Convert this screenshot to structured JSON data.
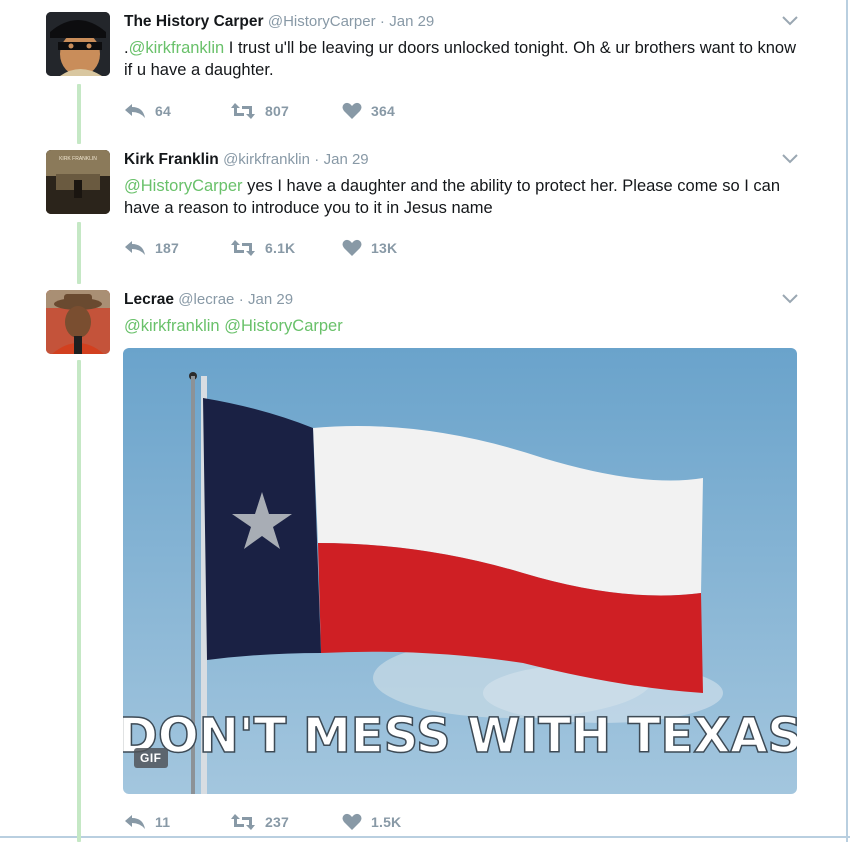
{
  "tweets": [
    {
      "name": "The History Carper",
      "handle": "@HistoryCarper",
      "date": "Jan 29",
      "text_prefix": ".",
      "mention": "@kirkfranklin",
      "text": " I trust u'll be leaving ur doors unlocked tonight. Oh & ur brothers want to know if u have a daughter.",
      "replies": "64",
      "retweets": "807",
      "likes": "364"
    },
    {
      "name": "Kirk Franklin",
      "handle": "@kirkfranklin",
      "date": "Jan 29",
      "mention": "@HistoryCarper",
      "text": " yes I have a daughter and the ability to protect her. Please come so I can have a reason to introduce you to it in Jesus name",
      "replies": "187",
      "retweets": "6.1K",
      "likes": "13K",
      "avatar_text": "KIRK FRANKLIN"
    },
    {
      "name": "Lecrae",
      "handle": "@lecrae",
      "date": "Jan 29",
      "mention1": "@kirkfranklin",
      "mention2": "@HistoryCarper",
      "gif_caption": "DON'T MESS WITH TEXAS",
      "gif_badge": "GIF",
      "replies": "11",
      "retweets": "237",
      "likes": "1.5K"
    }
  ],
  "colors": {
    "mention": "#69c16a",
    "action_gray": "#8899a6",
    "thread_line": "#c5e8c5",
    "flag_blue": "#1a2144",
    "flag_red": "#cf1f24",
    "sky": "#7fb2d6"
  }
}
